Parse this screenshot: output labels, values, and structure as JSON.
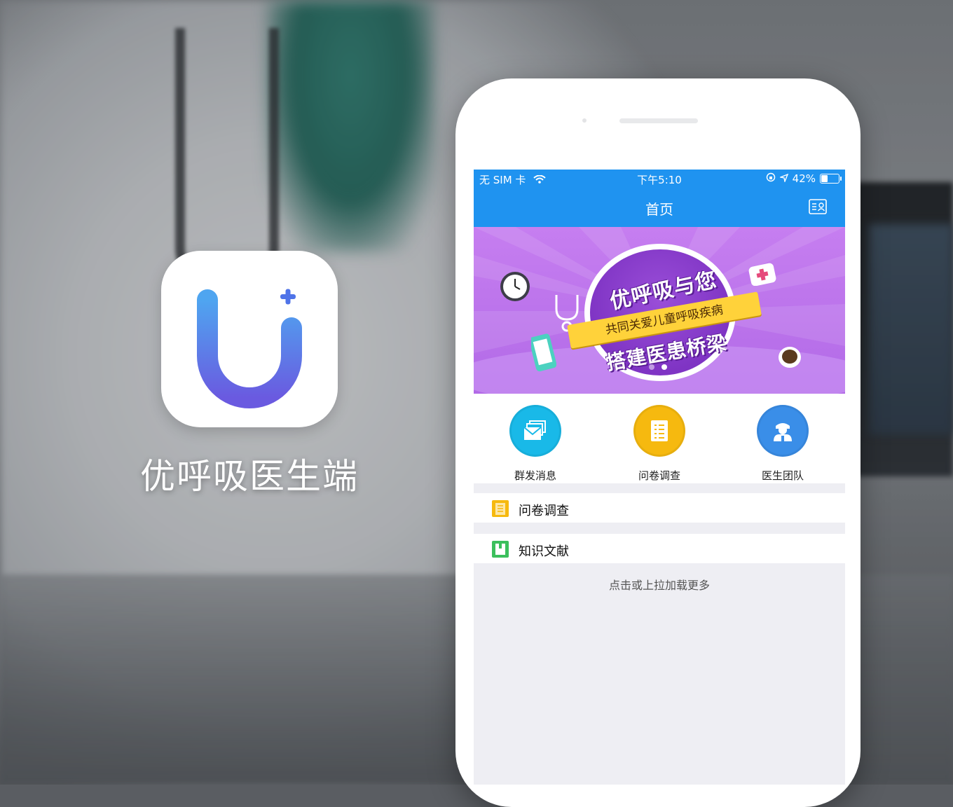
{
  "app": {
    "name": "优呼吸医生端"
  },
  "status_bar": {
    "carrier": "无 SIM 卡",
    "time": "下午5:10",
    "battery_percent": "42%",
    "battery_level": 0.42
  },
  "nav": {
    "title": "首页",
    "right_icon": "contact-card-icon"
  },
  "banner": {
    "headline": "优呼吸与您",
    "ribbon": "共同关爱儿童呼吸疾病",
    "subline": "搭建医患桥梁",
    "active_index": 1,
    "count": 2
  },
  "quick_actions": [
    {
      "label": "群发消息",
      "icon": "mail-icon",
      "color": "#19b9e8"
    },
    {
      "label": "问卷调查",
      "icon": "checklist-icon",
      "color": "#f6b90f"
    },
    {
      "label": "医生团队",
      "icon": "doctor-team-icon",
      "color": "#3a8ee8"
    }
  ],
  "sections": [
    {
      "label": "问卷调查",
      "icon": "document-icon",
      "color": "#f6b90f"
    },
    {
      "label": "知识文献",
      "icon": "book-icon",
      "color": "#3bbf5c"
    }
  ],
  "load_more": "点击或上拉加载更多",
  "colors": {
    "primary": "#1f93f0",
    "banner_purple": "#b978ec",
    "icon_gradient_top": "#4fa5f0",
    "icon_gradient_bottom": "#6a5ae0"
  }
}
